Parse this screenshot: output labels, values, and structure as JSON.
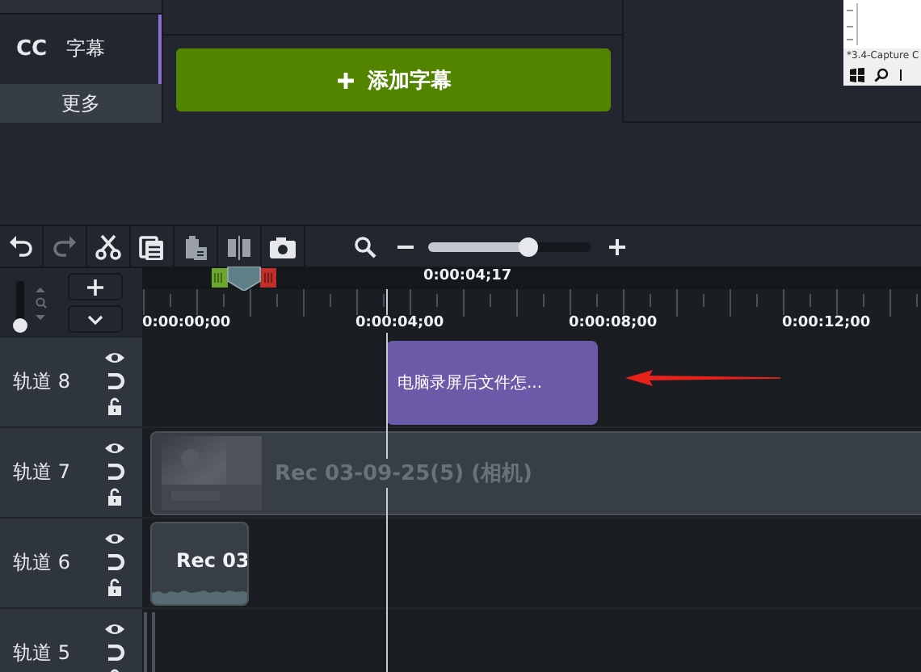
{
  "caption_tab": {
    "badge": "CC",
    "label": "字幕",
    "selected": true
  },
  "more_button": "更多",
  "add_caption_button": "添加字幕",
  "preview": {
    "caption": "*3.4-Capture C"
  },
  "toolbar": {
    "zoom": {
      "level": 0.61
    }
  },
  "timeline": {
    "track_zoom": {
      "level": 0
    },
    "playhead": {
      "time": "0:00:04;17"
    },
    "ruler": [
      "0:00:00;00",
      "0:00:04;00",
      "0:00:08;00",
      "0:00:12;00"
    ],
    "tracks": [
      {
        "name": "轨道 8",
        "clips": [
          {
            "kind": "caption",
            "label": "电脑录屏后文件怎..."
          }
        ]
      },
      {
        "name": "轨道 7",
        "clips": [
          {
            "kind": "video",
            "label": "Rec 03-09-25(5) (相机)"
          }
        ]
      },
      {
        "name": "轨道 6",
        "clips": [
          {
            "kind": "recording",
            "label": "Rec 03"
          }
        ]
      },
      {
        "name": "轨道 5",
        "clips": [
          {
            "kind": "edge"
          }
        ]
      }
    ]
  }
}
